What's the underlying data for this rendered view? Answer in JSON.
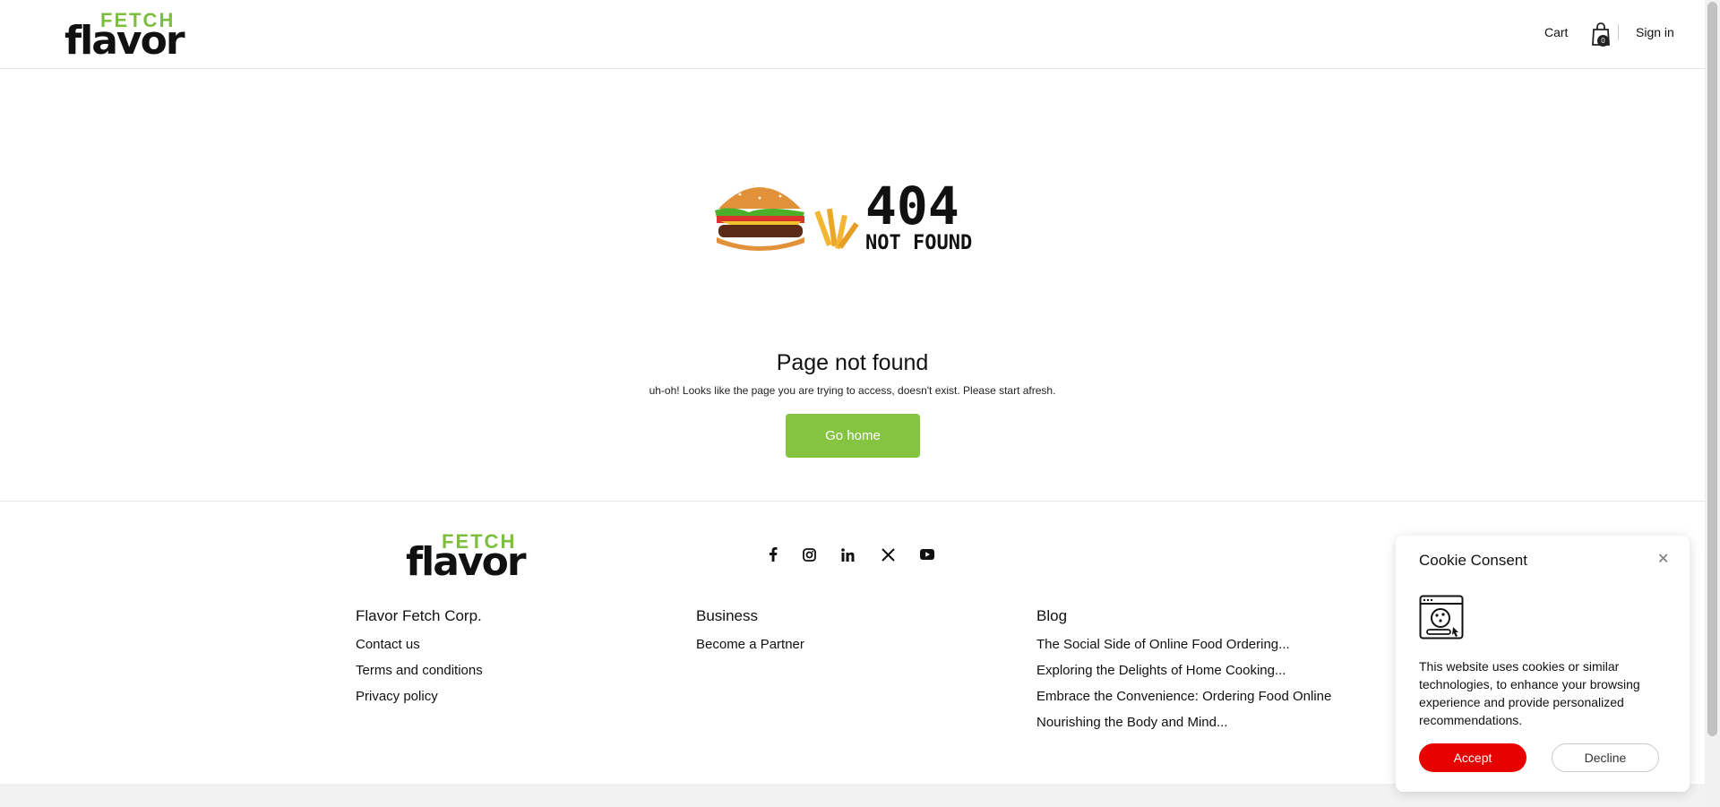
{
  "header": {
    "logo_top": "FETCH",
    "logo_bottom": "flavor",
    "cart_label": "Cart",
    "cart_count": "0",
    "signin_label": "Sign in"
  },
  "hero": {
    "code": "404",
    "code_sub": "NOT FOUND"
  },
  "main": {
    "title": "Page not found",
    "description": "uh-oh! Looks like the page you are trying to access, doesn't exist. Please start afresh.",
    "button_label": "Go home"
  },
  "footer": {
    "logo_top": "FETCH",
    "logo_bottom": "flavor",
    "social": [
      "facebook-icon",
      "instagram-icon",
      "linkedin-icon",
      "x-icon",
      "youtube-icon"
    ],
    "columns": [
      {
        "title": "Flavor Fetch Corp.",
        "links": [
          "Contact us",
          "Terms and conditions",
          "Privacy policy"
        ]
      },
      {
        "title": "Business",
        "links": [
          "Become a Partner"
        ]
      },
      {
        "title": "Blog",
        "links": [
          "The Social Side of Online Food Ordering...",
          "Exploring the Delights of Home Cooking...",
          "Embrace the Convenience: Ordering Food Online",
          "Nourishing the Body and Mind..."
        ]
      }
    ]
  },
  "cookie": {
    "title": "Cookie Consent",
    "text": "This website uses cookies or similar technologies, to enhance your browsing experience and provide personalized recommendations.",
    "accept_label": "Accept",
    "decline_label": "Decline"
  },
  "colors": {
    "brand_green": "#85c441",
    "accept_red": "#e60000"
  }
}
